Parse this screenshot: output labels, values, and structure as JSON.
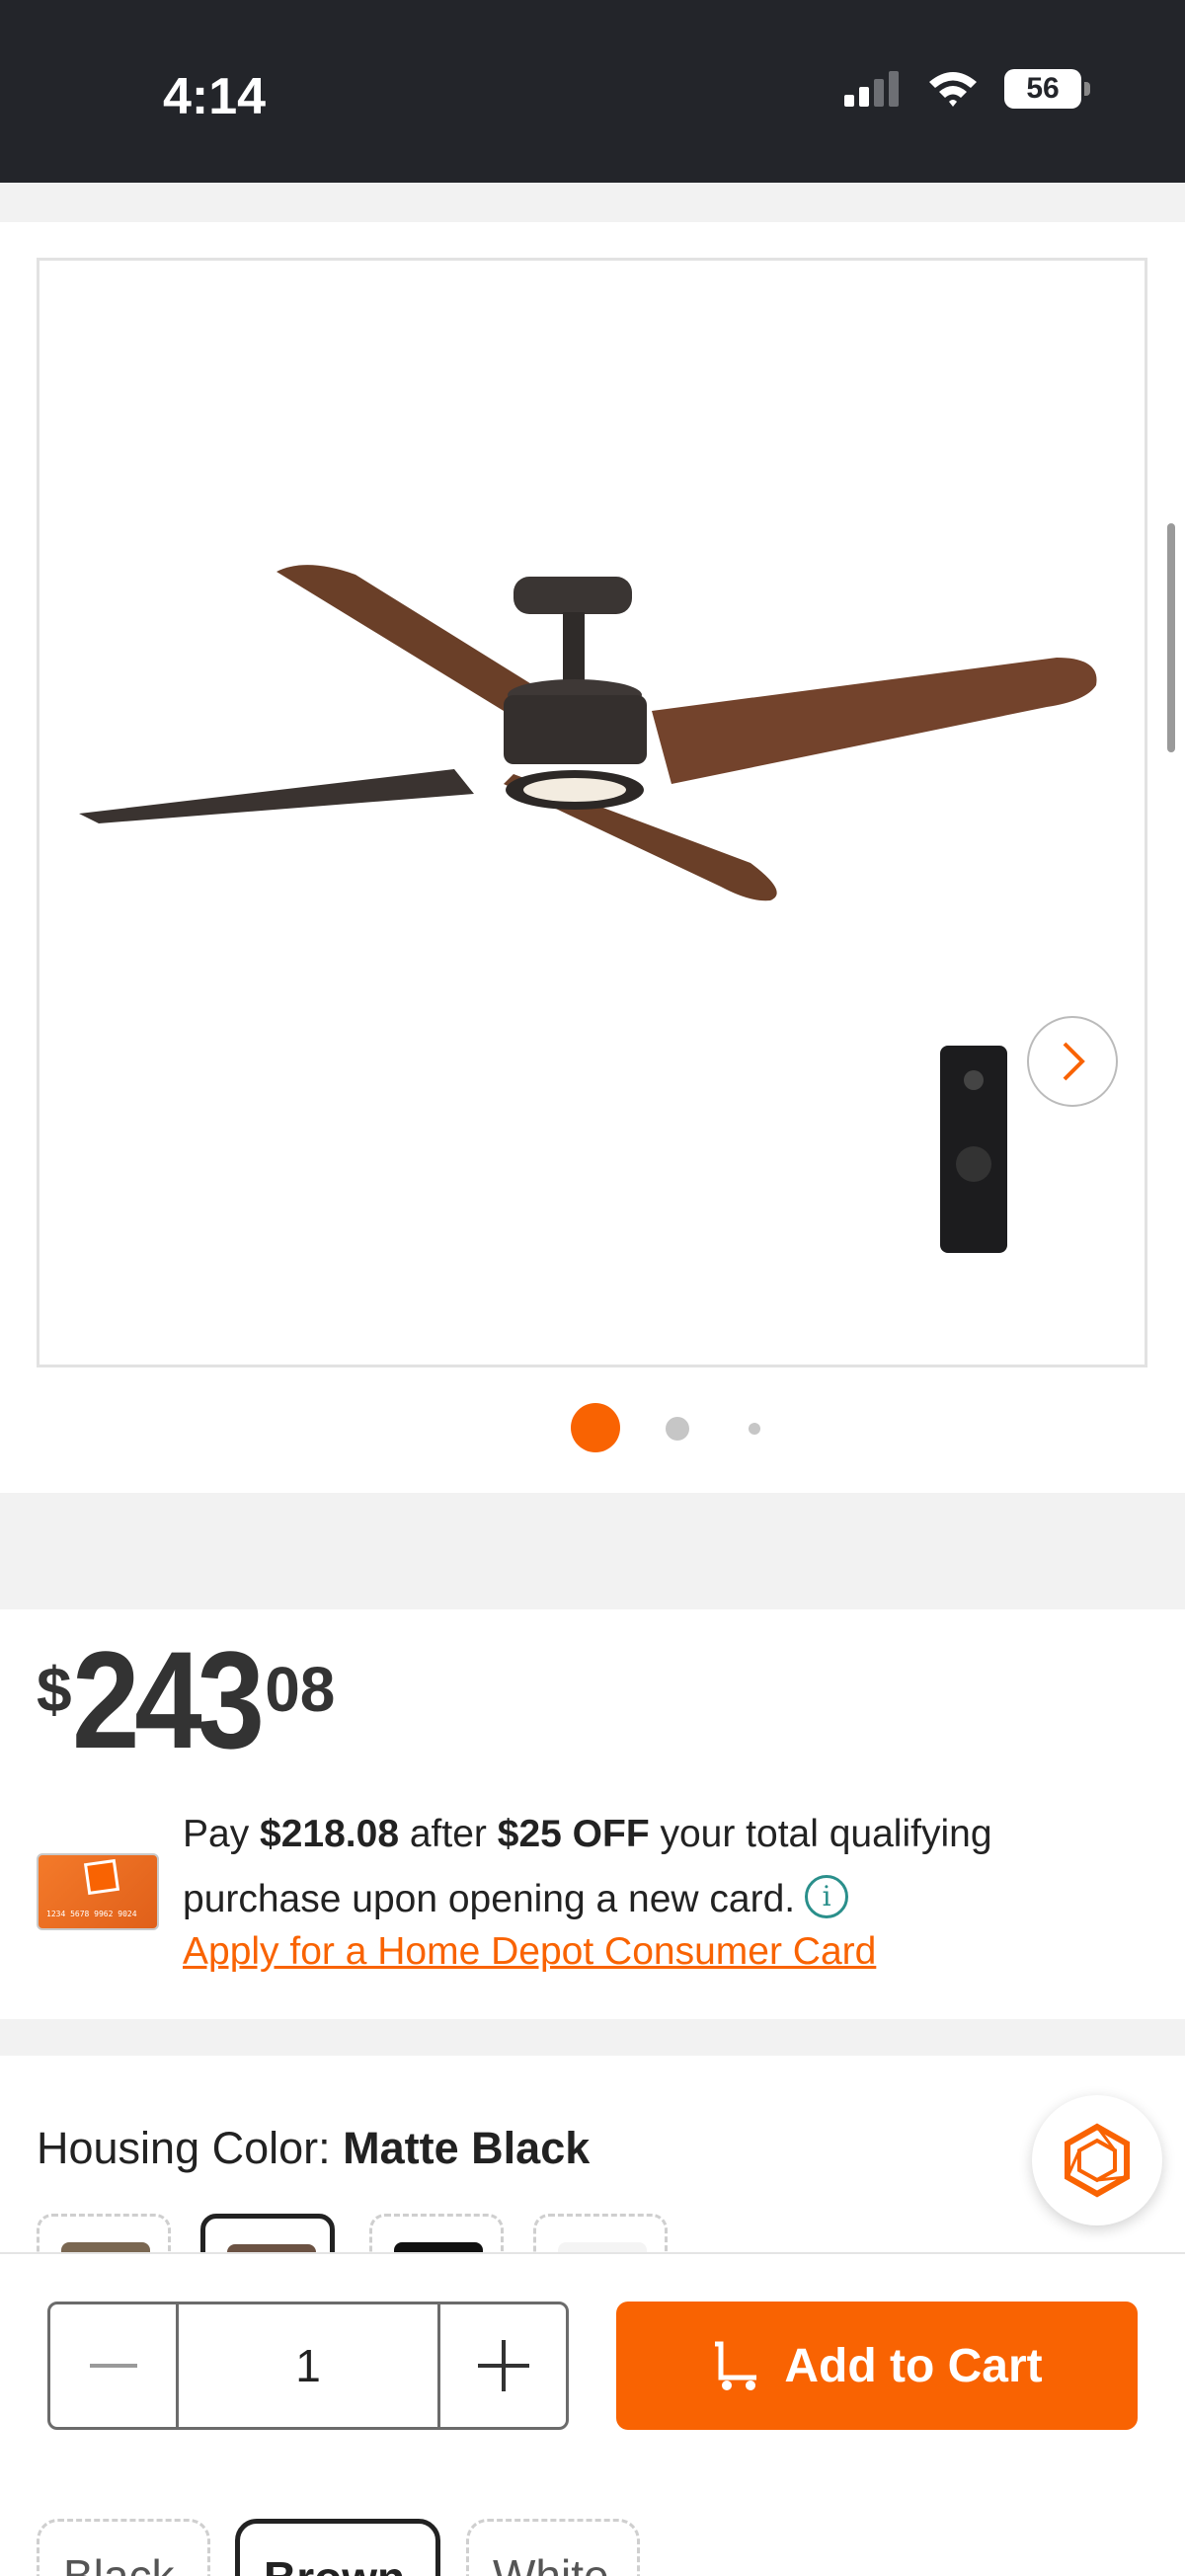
{
  "status_bar": {
    "time": "4:14",
    "battery": "56"
  },
  "gallery": {
    "image_alt": "Ceiling fan with wood-tone blades, LED light kit and remote control",
    "page_count": 3,
    "current_page": 1
  },
  "price": {
    "currency": "$",
    "dollars": "243",
    "cents": "08"
  },
  "promo": {
    "text_1": "Pay ",
    "amount": "$218.08",
    "text_2": " after ",
    "discount": "$25 OFF",
    "text_3": " your total qualifying purchase upon opening a new card.",
    "link": "Apply for a Home Depot Consumer Card",
    "card_number": "1234 5678 9962 9024"
  },
  "housing_color": {
    "label": "Housing Color: ",
    "selected": "Matte Black",
    "swatches": [
      {
        "name": "wood-swatch",
        "color": "#7a6752"
      },
      {
        "name": "brown-swatch",
        "color": "#6b5243"
      },
      {
        "name": "black-swatch",
        "color": "#111111"
      },
      {
        "name": "white-swatch",
        "color": "#f4f4f4"
      }
    ]
  },
  "cart": {
    "quantity": "1",
    "add_label": "Add to Cart"
  },
  "blade_colors": [
    "Black",
    "Brown",
    "White"
  ],
  "colors": {
    "accent": "#f96302",
    "status_bar": "#23252a",
    "info": "#2a8f8b"
  }
}
